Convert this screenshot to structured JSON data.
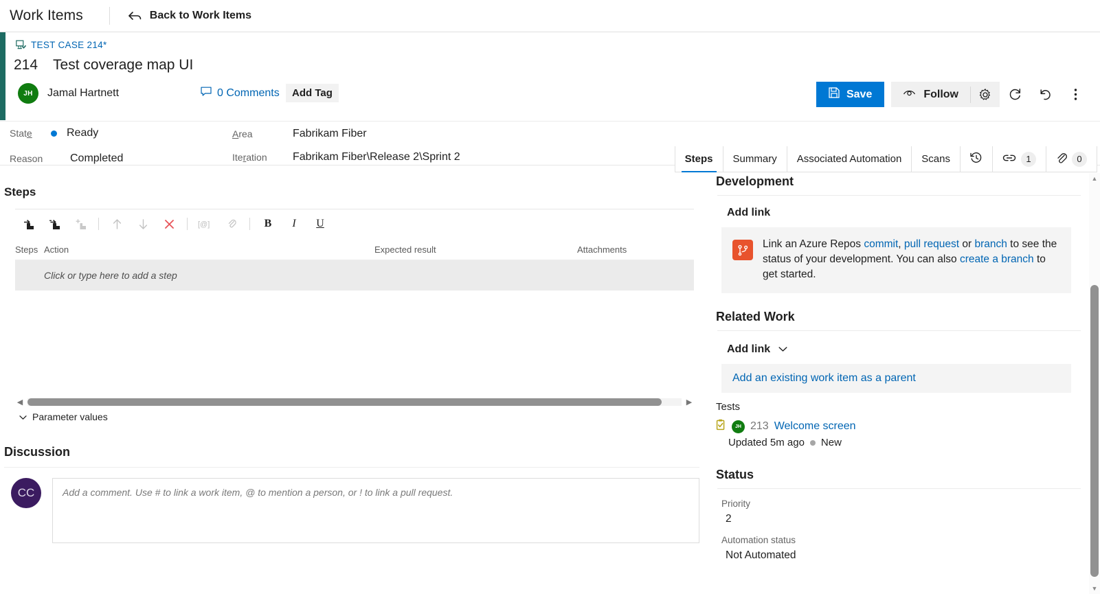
{
  "topnav": {
    "title": "Work Items",
    "back_label": "Back to Work Items",
    "back_icon": "back-arrow-icon"
  },
  "workitem": {
    "type_label": "TEST CASE 214*",
    "type_icon": "test-case-icon",
    "id": "214",
    "title": "Test coverage map UI",
    "assignee": "Jamal Hartnett",
    "assignee_initials": "JH",
    "comments_label": "0 Comments",
    "comments_icon": "comment-bubble-icon",
    "add_tag_label": "Add Tag",
    "accent_color": "#1d6b62"
  },
  "actions": {
    "save_label": "Save",
    "save_icon": "save-disk-icon",
    "save_color": "#0078d4",
    "follow_label": "Follow",
    "follow_icon": "eye-icon",
    "gear_icon": "gear-icon",
    "refresh_icon": "refresh-icon",
    "revert_icon": "undo-icon",
    "more_icon": "more-vertical-icon"
  },
  "fields": {
    "state_label": "State",
    "state_value": "Ready",
    "state_color": "#0078d4",
    "reason_label": "Reason",
    "reason_value": "Completed",
    "area_label": "Area",
    "area_value": "Fabrikam Fiber",
    "iteration_label": "Iteration",
    "iteration_value": "Fabrikam Fiber\\Release 2\\Sprint 2"
  },
  "tabs": [
    {
      "label": "Steps",
      "active": true
    },
    {
      "label": "Summary",
      "active": false
    },
    {
      "label": "Associated Automation",
      "active": false
    },
    {
      "label": "Scans",
      "active": false
    }
  ],
  "tab_icons": {
    "history_icon": "history-clock-icon",
    "links_icon": "link-icon",
    "links_count": "1",
    "attachments_icon": "paperclip-icon",
    "attachments_count": "0"
  },
  "steps": {
    "section_title": "Steps",
    "toolbar": [
      {
        "name": "insert-step-icon",
        "disabled": false
      },
      {
        "name": "insert-shared-step-icon",
        "disabled": false
      },
      {
        "name": "insert-step-parameter-icon",
        "disabled": true
      },
      {
        "name": "move-up-icon",
        "disabled": true
      },
      {
        "name": "move-down-icon",
        "disabled": true
      },
      {
        "name": "delete-step-icon",
        "disabled": false
      },
      {
        "name": "insert-parameter-icon",
        "disabled": true
      },
      {
        "name": "attach-file-icon",
        "disabled": true
      },
      {
        "name": "bold-icon",
        "disabled": false
      },
      {
        "name": "italic-icon",
        "disabled": false
      },
      {
        "name": "underline-icon",
        "disabled": false
      }
    ],
    "columns": {
      "steps": "Steps",
      "action": "Action",
      "expected": "Expected result",
      "attachments": "Attachments"
    },
    "row_placeholder": "Click or type here to add a step",
    "parameter_values_label": "Parameter values"
  },
  "discussion": {
    "title": "Discussion",
    "avatar_initials": "CC",
    "placeholder": "Add a comment. Use # to link a work item, @ to mention a person, or ! to link a pull request."
  },
  "development": {
    "title": "Development",
    "add_link_label": "Add link",
    "icon": "azure-repos-icon",
    "icon_color": "#e8532d",
    "text_part1": "Link an Azure Repos ",
    "link_commit": "commit",
    "text_comma": ", ",
    "link_pull_request": "pull request",
    "text_or": " or ",
    "link_branch": "branch",
    "text_part2": " to see the status of your development. You can also ",
    "link_create_branch": "create a branch",
    "text_part3": " to get started."
  },
  "related_work": {
    "title": "Related Work",
    "add_link_label": "Add link",
    "chevron_icon": "chevron-down-icon",
    "parent_banner": "Add an existing work item as a parent",
    "group_label": "Tests",
    "item": {
      "icon": "test-case-clipboard-icon",
      "avatar_initials": "JH",
      "id": "213",
      "name": "Welcome screen",
      "updated": "Updated 5m ago",
      "state": "New"
    }
  },
  "status": {
    "title": "Status",
    "priority_label": "Priority",
    "priority_value": "2",
    "automation_label": "Automation status",
    "automation_value": "Not Automated"
  }
}
